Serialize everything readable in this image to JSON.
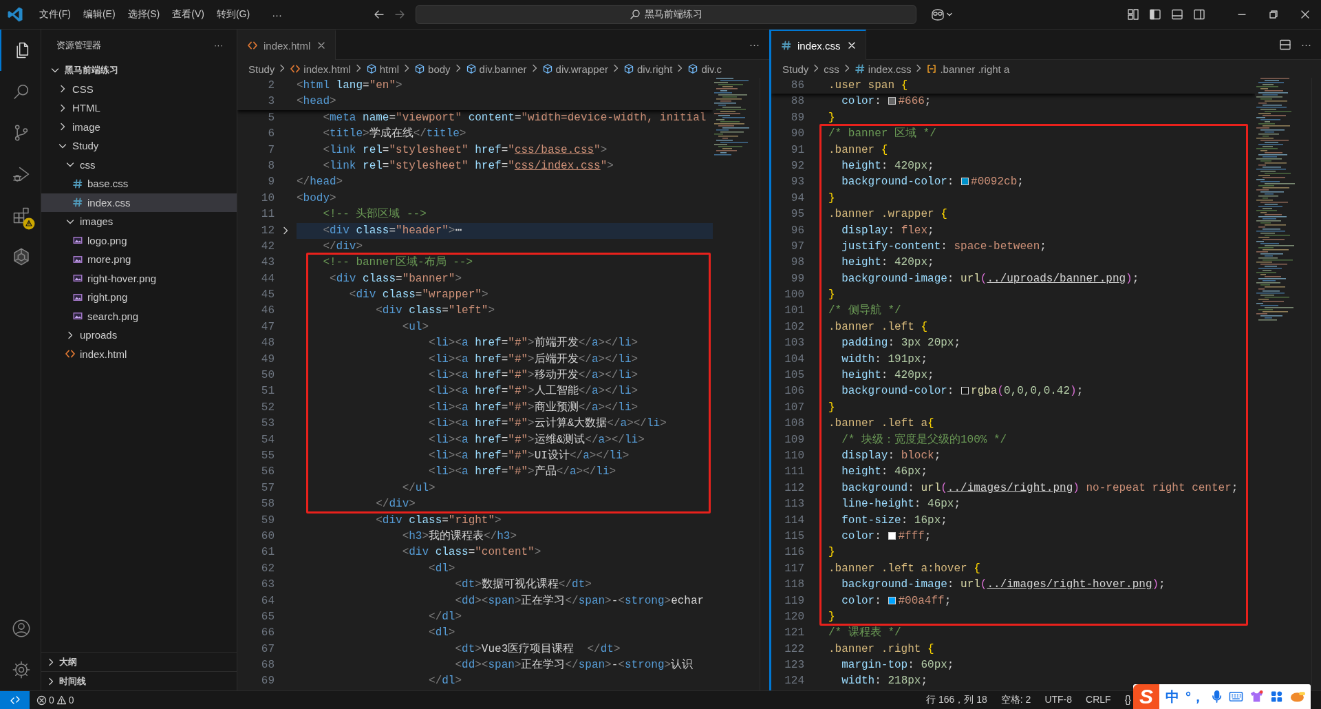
{
  "titlebar": {
    "menus": [
      "文件(F)",
      "编辑(E)",
      "选择(S)",
      "查看(V)",
      "转到(G)"
    ],
    "more": "···",
    "search": "黑马前端练习"
  },
  "activity": {
    "items": [
      {
        "kind": "files",
        "selected": true,
        "warning": false
      },
      {
        "kind": "search",
        "selected": false,
        "warning": false
      },
      {
        "kind": "source-control",
        "selected": false,
        "warning": false
      },
      {
        "kind": "run-debug",
        "selected": false,
        "warning": false
      },
      {
        "kind": "extensions",
        "selected": false,
        "warning": true
      },
      {
        "kind": "knot",
        "selected": false,
        "warning": false
      }
    ],
    "bottom": [
      {
        "kind": "account"
      },
      {
        "kind": "settings"
      }
    ]
  },
  "sidebar": {
    "title": "资源管理器",
    "more": "···",
    "tree": [
      {
        "label": "黑马前端练习",
        "kind": "folder",
        "expanded": true,
        "selected": false,
        "children": [
          {
            "label": "CSS",
            "kind": "folder",
            "expanded": false,
            "selected": false
          },
          {
            "label": "HTML",
            "kind": "folder",
            "expanded": false,
            "selected": false
          },
          {
            "label": "image",
            "kind": "folder",
            "expanded": false,
            "selected": false
          },
          {
            "label": "Study",
            "kind": "folder",
            "expanded": true,
            "selected": false,
            "children": [
              {
                "label": "css",
                "kind": "folder",
                "expanded": true,
                "selected": false,
                "children": [
                  {
                    "label": "base.css",
                    "kind": "css",
                    "selected": false
                  },
                  {
                    "label": "index.css",
                    "kind": "css",
                    "selected": true
                  }
                ]
              },
              {
                "label": "images",
                "kind": "folder",
                "expanded": true,
                "selected": false,
                "children": [
                  {
                    "label": "logo.png",
                    "kind": "image",
                    "selected": false
                  },
                  {
                    "label": "more.png",
                    "kind": "image",
                    "selected": false
                  },
                  {
                    "label": "right-hover.png",
                    "kind": "image",
                    "selected": false
                  },
                  {
                    "label": "right.png",
                    "kind": "image",
                    "selected": false
                  },
                  {
                    "label": "search.png",
                    "kind": "image",
                    "selected": false
                  }
                ]
              },
              {
                "label": "uproads",
                "kind": "folder",
                "expanded": false,
                "selected": false
              },
              {
                "label": "index.html",
                "kind": "html",
                "selected": false
              }
            ]
          }
        ]
      }
    ],
    "panels": [
      {
        "label": "大纲",
        "expanded": false
      },
      {
        "label": "时间线",
        "expanded": false
      }
    ]
  },
  "editors": [
    {
      "kind": "html",
      "tab": {
        "label": "index.html",
        "kind": "html",
        "focused": false
      },
      "actions": [
        {
          "kind": "more",
          "label": "···"
        }
      ],
      "breadcrumbs": [
        {
          "label": "Study"
        },
        {
          "label": "index.html",
          "kind": "html"
        },
        {
          "label": "html",
          "kind": "symbol"
        },
        {
          "label": "body",
          "kind": "symbol"
        },
        {
          "label": "div.banner",
          "kind": "symbol"
        },
        {
          "label": "div.wrapper",
          "kind": "symbol"
        },
        {
          "label": "div.right",
          "kind": "symbol"
        },
        {
          "label": "div.c",
          "kind": "symbol"
        }
      ],
      "sticky": [
        {
          "number": "2",
          "folded": false,
          "text": "<html lang=\"en\">"
        },
        {
          "number": "3",
          "folded": false,
          "text": "<head>"
        }
      ],
      "segments": [
        {
          "boxed": false,
          "lines": [
            {
              "number": "5",
              "folded": false,
              "text": "    <meta name=\"viewport\" content=\"width=device-width, initial"
            },
            {
              "number": "6",
              "folded": false,
              "text": "    <title>学成在线</title>"
            },
            {
              "number": "7",
              "folded": false,
              "text": "    <link rel=\"stylesheet\" href=\"css/base.css\">"
            },
            {
              "number": "8",
              "folded": false,
              "text": "    <link rel=\"stylesheet\" href=\"css/index.css\">"
            },
            {
              "number": "9",
              "folded": false,
              "text": "</head>"
            },
            {
              "number": "10",
              "folded": false,
              "text": "<body>"
            },
            {
              "number": "11",
              "folded": false,
              "text": "    <!-- 头部区域 -->"
            },
            {
              "number": "12",
              "folded": true,
              "text": "    <div class=\"header\">⋯"
            },
            {
              "number": "42",
              "folded": false,
              "text": "    </div>"
            }
          ]
        },
        {
          "boxed": true,
          "lines": [
            {
              "number": "43",
              "folded": false,
              "text": "    <!-- banner区域-布局 -->"
            },
            {
              "number": "44",
              "folded": false,
              "text": "     <div class=\"banner\">"
            },
            {
              "number": "45",
              "folded": false,
              "text": "        <div class=\"wrapper\">"
            },
            {
              "number": "46",
              "folded": false,
              "text": "            <div class=\"left\">"
            },
            {
              "number": "47",
              "folded": false,
              "text": "                <ul>"
            },
            {
              "number": "48",
              "folded": false,
              "text": "                    <li><a href=\"#\">前端开发</a></li>"
            },
            {
              "number": "49",
              "folded": false,
              "text": "                    <li><a href=\"#\">后端开发</a></li>"
            },
            {
              "number": "50",
              "folded": false,
              "text": "                    <li><a href=\"#\">移动开发</a></li>"
            },
            {
              "number": "51",
              "folded": false,
              "text": "                    <li><a href=\"#\">人工智能</a></li>"
            },
            {
              "number": "52",
              "folded": false,
              "text": "                    <li><a href=\"#\">商业预测</a></li>"
            },
            {
              "number": "53",
              "folded": false,
              "text": "                    <li><a href=\"#\">云计算&大数据</a></li>"
            },
            {
              "number": "54",
              "folded": false,
              "text": "                    <li><a href=\"#\">运维&测试</a></li>"
            },
            {
              "number": "55",
              "folded": false,
              "text": "                    <li><a href=\"#\">UI设计</a></li>"
            },
            {
              "number": "56",
              "folded": false,
              "text": "                    <li><a href=\"#\">产品</a></li>"
            },
            {
              "number": "57",
              "folded": false,
              "text": "                </ul>"
            },
            {
              "number": "58",
              "folded": false,
              "text": "            </div>"
            }
          ]
        },
        {
          "boxed": false,
          "lines": [
            {
              "number": "59",
              "folded": false,
              "text": "            <div class=\"right\">"
            },
            {
              "number": "60",
              "folded": false,
              "text": "                <h3>我的课程表</h3>"
            },
            {
              "number": "61",
              "folded": false,
              "text": "                <div class=\"content\">"
            },
            {
              "number": "62",
              "folded": false,
              "text": "                    <dl>"
            },
            {
              "number": "63",
              "folded": false,
              "text": "                        <dt>数据可视化课程</dt>"
            },
            {
              "number": "64",
              "folded": false,
              "text": "                        <dd><span>正在学习</span>-<strong>echar"
            },
            {
              "number": "65",
              "folded": false,
              "text": "                    </dl>"
            },
            {
              "number": "66",
              "folded": false,
              "text": "                    <dl>"
            },
            {
              "number": "67",
              "folded": false,
              "text": "                        <dt>Vue3医疗项目课程  </dt>"
            },
            {
              "number": "68",
              "folded": false,
              "text": "                        <dd><span>正在学习</span>-<strong>认识"
            },
            {
              "number": "69",
              "folded": false,
              "text": "                    </dl>"
            }
          ]
        }
      ]
    },
    {
      "kind": "css",
      "tab": {
        "label": "index.css",
        "kind": "css",
        "focused": true
      },
      "actions": [
        {
          "kind": "split"
        },
        {
          "kind": "more",
          "label": "···"
        }
      ],
      "breadcrumbs": [
        {
          "label": "Study"
        },
        {
          "label": "css"
        },
        {
          "label": "index.css",
          "kind": "css"
        },
        {
          "label": ".banner .right a",
          "kind": "selector"
        }
      ],
      "sticky": [
        {
          "number": "86",
          "folded": false,
          "text": ".user span {"
        }
      ],
      "segments": [
        {
          "boxed": false,
          "lines": [
            {
              "number": "88",
              "folded": false,
              "text": "  color: #666;"
            },
            {
              "number": "89",
              "folded": false,
              "text": "}"
            }
          ]
        },
        {
          "boxed": true,
          "lines": [
            {
              "number": "90",
              "folded": false,
              "text": "/* banner 区域 */"
            },
            {
              "number": "91",
              "folded": false,
              "text": ".banner {"
            },
            {
              "number": "92",
              "folded": false,
              "text": "  height: 420px;"
            },
            {
              "number": "93",
              "folded": false,
              "text": "  background-color: #0092cb;"
            },
            {
              "number": "94",
              "folded": false,
              "text": "}"
            },
            {
              "number": "95",
              "folded": false,
              "text": ".banner .wrapper {"
            },
            {
              "number": "96",
              "folded": false,
              "text": "  display: flex;"
            },
            {
              "number": "97",
              "folded": false,
              "text": "  justify-content: space-between;"
            },
            {
              "number": "98",
              "folded": false,
              "text": "  height: 420px;"
            },
            {
              "number": "99",
              "folded": false,
              "text": "  background-image: url(../uproads/banner.png);"
            },
            {
              "number": "100",
              "folded": false,
              "text": "}"
            },
            {
              "number": "101",
              "folded": false,
              "text": "/* 侧导航 */"
            },
            {
              "number": "102",
              "folded": false,
              "text": ".banner .left {"
            },
            {
              "number": "103",
              "folded": false,
              "text": "  padding: 3px 20px;"
            },
            {
              "number": "104",
              "folded": false,
              "text": "  width: 191px;"
            },
            {
              "number": "105",
              "folded": false,
              "text": "  height: 420px;"
            },
            {
              "number": "106",
              "folded": false,
              "text": "  background-color: rgba(0,0,0,0.42);"
            },
            {
              "number": "107",
              "folded": false,
              "text": "}"
            },
            {
              "number": "108",
              "folded": false,
              "text": ".banner .left a{"
            },
            {
              "number": "109",
              "folded": false,
              "text": "  /* 块级：宽度是父级的100% */"
            },
            {
              "number": "110",
              "folded": false,
              "text": "  display: block;"
            },
            {
              "number": "111",
              "folded": false,
              "text": "  height: 46px;"
            },
            {
              "number": "112",
              "folded": false,
              "text": "  background: url(../images/right.png) no-repeat right center;"
            },
            {
              "number": "113",
              "folded": false,
              "text": "  line-height: 46px;"
            },
            {
              "number": "114",
              "folded": false,
              "text": "  font-size: 16px;"
            },
            {
              "number": "115",
              "folded": false,
              "text": "  color: #fff;"
            },
            {
              "number": "116",
              "folded": false,
              "text": "}"
            },
            {
              "number": "117",
              "folded": false,
              "text": ".banner .left a:hover {"
            },
            {
              "number": "118",
              "folded": false,
              "text": "  background-image: url(../images/right-hover.png);"
            },
            {
              "number": "119",
              "folded": false,
              "text": "  color: #00a4ff;"
            },
            {
              "number": "120",
              "folded": false,
              "text": "}"
            }
          ]
        },
        {
          "boxed": false,
          "lines": [
            {
              "number": "121",
              "folded": false,
              "text": "/* 课程表 */"
            },
            {
              "number": "122",
              "folded": false,
              "text": ".banner .right {"
            },
            {
              "number": "123",
              "folded": false,
              "text": "  margin-top: 60px;"
            },
            {
              "number": "124",
              "folded": false,
              "text": "  width: 218px;"
            }
          ]
        }
      ]
    }
  ],
  "status": {
    "errors": "0",
    "warnings": "0",
    "position": "行 166，列 18",
    "indent": "空格: 2",
    "encoding": "UTF-8",
    "eol": "CRLF",
    "language": "{}"
  },
  "ime": {
    "logo": "S",
    "mode": "中",
    "punct": "°，"
  }
}
